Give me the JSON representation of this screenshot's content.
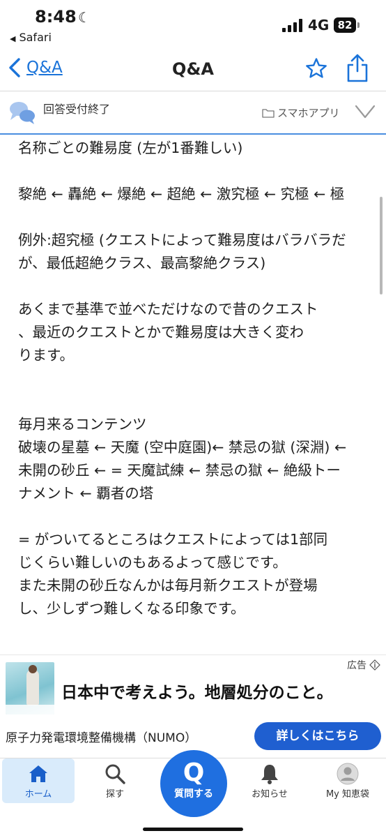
{
  "status_bar": {
    "time": "8:48",
    "back_app": "Safari",
    "network": "4G",
    "battery": "82"
  },
  "nav": {
    "back_label": "Q&A",
    "title": "Q&A"
  },
  "question": {
    "status": "回答受付終了",
    "category": "スマホアプリ"
  },
  "answer": {
    "p1": "名称ごとの難易度 (左が1番難しい)",
    "p2": "黎絶 ← 轟絶 ← 爆絶 ← 超絶 ← 激究極 ← 究極 ← 極",
    "p3": "例外:超究極 (クエストによって難易度はバラバラだが、最低超絶クラス、最高黎絶クラス)",
    "p4": "あくまで基準で並べただけなので昔のクエスト\n、最近のクエストとかで難易度は大きく変わ\nります。",
    "p5": "毎月来るコンテンツ\n破壊の星墓 ← 天魔 (空中庭園)← 禁忌の獄 (深淵) ←\n未開の砂丘 ← = 天魔試練 ← 禁忌の獄 ← 絶級トー\nナメント ← 覇者の塔",
    "p6": "= がついてるところはクエストによっては1部同\nじくらい難しいのもあるよって感じです。\nまた未開の砂丘なんかは毎月新クエストが登場\nし、少しずつ難しくなる印象です。"
  },
  "ad": {
    "label": "広告",
    "headline": "日本中で考えよう。地層処分のこと。",
    "sponsor": "原子力発電環境整備機構（NUMO）",
    "cta": "詳しくはこちら"
  },
  "tabbar": {
    "home": "ホーム",
    "search": "探す",
    "ask_glyph": "Q",
    "ask": "質問する",
    "notifications": "お知らせ",
    "mypage": "My 知恵袋"
  },
  "colors": {
    "accent": "#1a73d9",
    "ask_button": "#1f6fe0",
    "cta_button": "#1f5fd0",
    "home_tab_bg": "#d9ebfb"
  }
}
